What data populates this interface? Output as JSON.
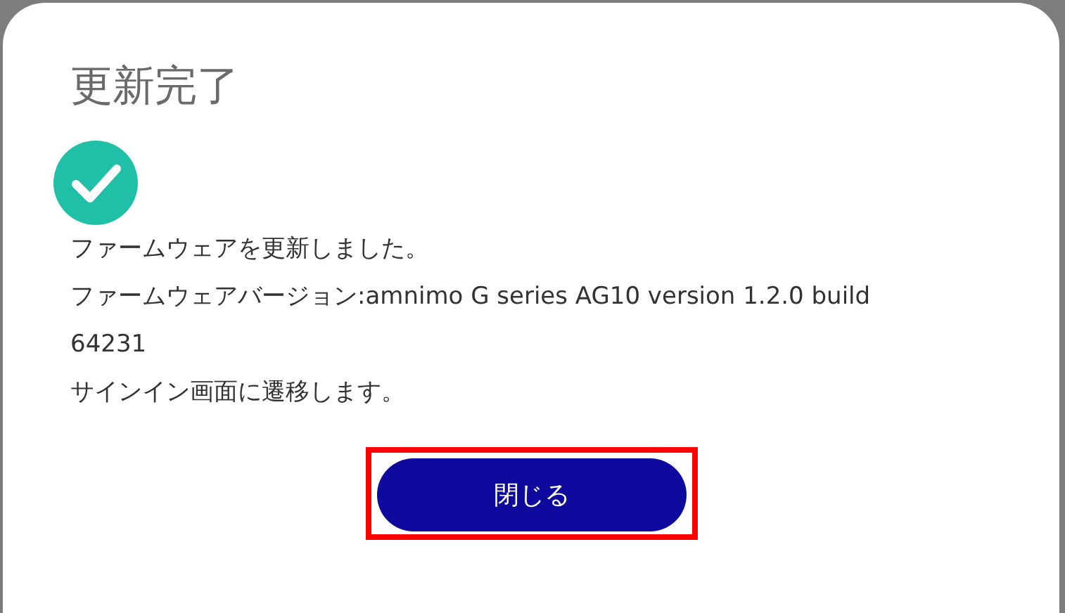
{
  "dialog": {
    "title": "更新完了",
    "status_icon": {
      "kind": "check"
    },
    "messages": [
      "ファームウェアを更新しました。",
      "ファームウェアバージョン:amnimo G series AG10 version 1.2.0 build 64231",
      "サインイン画面に遷移します。"
    ],
    "close_button": {
      "label": "閉じる",
      "highlighted": true
    }
  }
}
